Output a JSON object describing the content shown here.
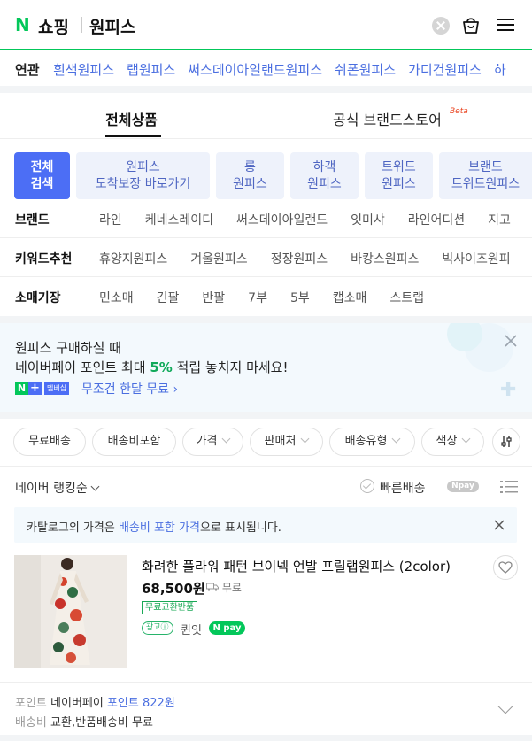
{
  "header": {
    "logo": "N",
    "service": "쇼핑",
    "query": "원피스"
  },
  "related": {
    "label": "연관",
    "items": [
      "흰색원피스",
      "랩원피스",
      "써스데이아일랜드원피스",
      "쉬폰원피스",
      "가디건원피스",
      "하"
    ]
  },
  "tabs": {
    "all": "전체상품",
    "brand": "공식 브랜드스토어",
    "beta": "Beta"
  },
  "chips": {
    "all_line1": "전체",
    "all_line2": "검색",
    "items": [
      {
        "line1": "원피스",
        "line2": "도착보장 바로가기"
      },
      {
        "line1": "롱",
        "line2": "원피스"
      },
      {
        "line1": "하객",
        "line2": "원피스"
      },
      {
        "line1": "트위드",
        "line2": "원피스"
      },
      {
        "line1": "브랜드",
        "line2": "트위드원피스"
      }
    ]
  },
  "filters": {
    "brand": {
      "label": "브랜드",
      "items": [
        "라인",
        "케네스레이디",
        "써스데이아일랜드",
        "잇미샤",
        "라인어디션",
        "지고"
      ]
    },
    "keyword": {
      "label": "키워드추천",
      "items": [
        "휴양지원피스",
        "겨울원피스",
        "정장원피스",
        "바캉스원피스",
        "빅사이즈원피"
      ]
    },
    "sleeve": {
      "label": "소매기장",
      "items": [
        "민소매",
        "긴팔",
        "반팔",
        "7부",
        "5부",
        "캡소매",
        "스트랩"
      ]
    }
  },
  "promo": {
    "line1": "원피스 구매하실 때",
    "line2_pre": "네이버페이 포인트 최대 ",
    "line2_pct": "5%",
    "line2_post": " 적립 놓치지 마세요!",
    "badge_n": "N",
    "badge_plus": "+",
    "badge_mem": "멤버십",
    "link": "무조건 한달 무료 ›"
  },
  "pills": [
    "무료배송",
    "배송비포함",
    "가격",
    "판매처",
    "배송유형",
    "색상"
  ],
  "ranking": {
    "sort": "네이버 랭킹순",
    "fast": "빠른배송",
    "npay": "Npay"
  },
  "notice": {
    "pre": "카탈로그의 가격은 ",
    "highlight": "배송비 포함 가격",
    "post": "으로 표시됩니다."
  },
  "product": {
    "title": "화려한 플라워 패턴 브이넥 언발 프릴랩원피스 (2color)",
    "price": "68,500원",
    "shipping": "무료",
    "free_return": "무료교환반품",
    "ad": "광고ⓘ",
    "seller": "퀸잇",
    "npay": "N pay"
  },
  "bottom": {
    "point_key": "포인트",
    "point_pre": "네이버페이 ",
    "point_link": "포인트",
    "point_val": "822원",
    "ship_key": "배송비",
    "ship_val": "교환,반품배송비 무료"
  },
  "colors": {
    "naver_green": "#03c75a",
    "link_blue": "#4a6ee0",
    "chip_blue": "#4c6ef5"
  }
}
